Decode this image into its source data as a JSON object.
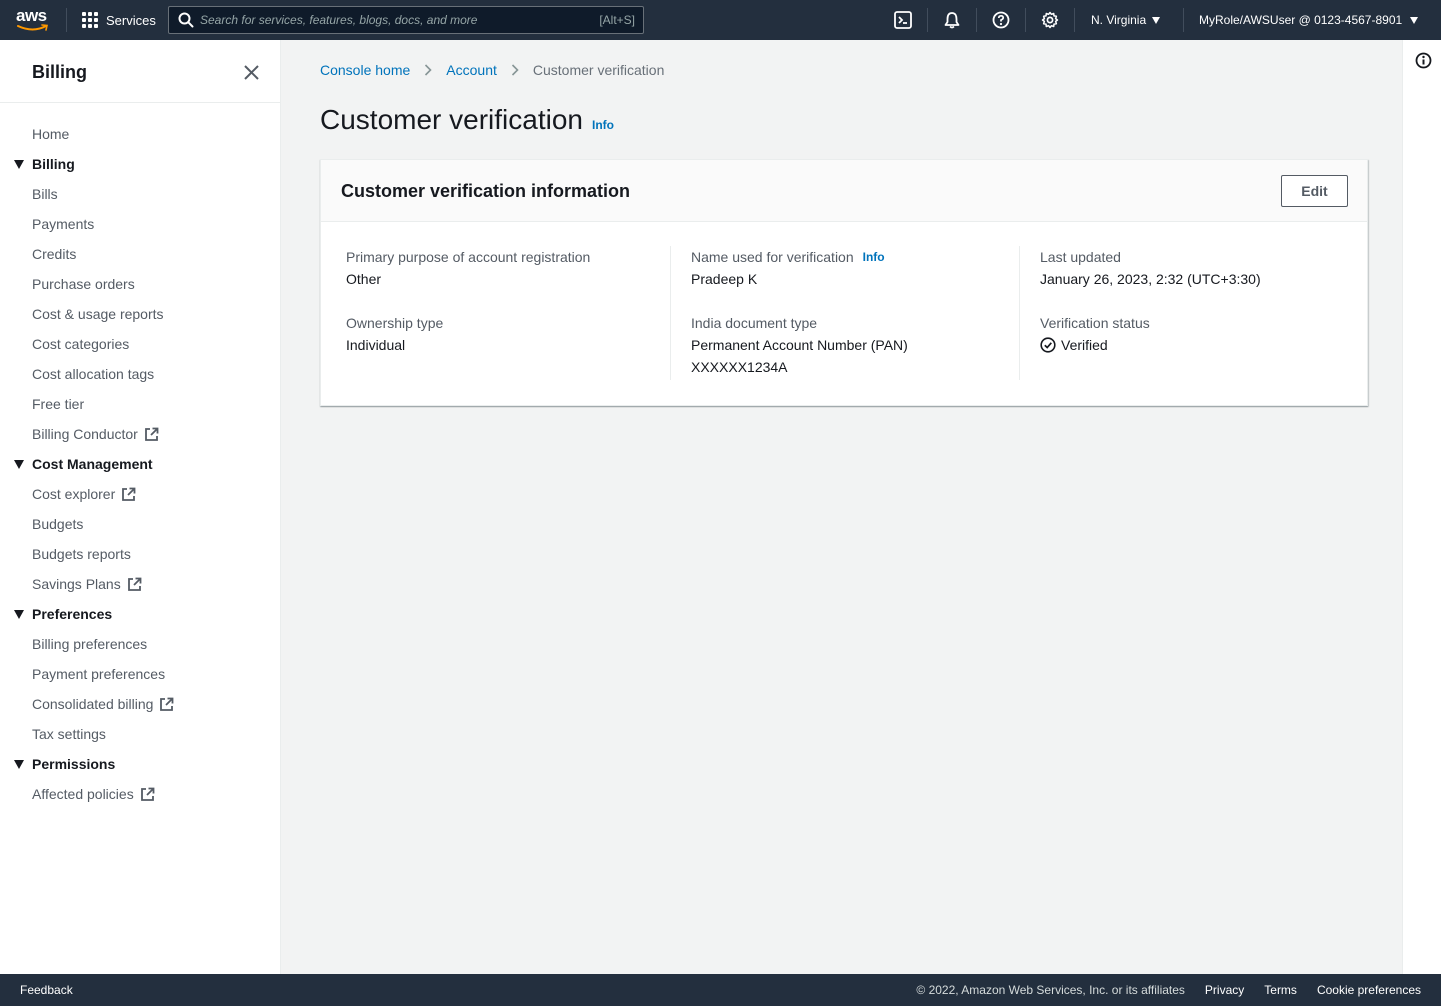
{
  "topnav": {
    "logo": "aws",
    "services_label": "Services",
    "search_placeholder": "Search for services, features, blogs, docs, and more",
    "search_shortcut": "[Alt+S]",
    "region": "N. Virginia",
    "account": "MyRole/AWSUser @ 0123-4567-8901",
    "icons": [
      "cloudshell-icon",
      "bell-icon",
      "help-icon",
      "gear-icon"
    ]
  },
  "sidebar": {
    "title": "Billing",
    "items": [
      {
        "label": "Home",
        "type": "link"
      },
      {
        "label": "Billing",
        "type": "section"
      },
      {
        "label": "Bills",
        "type": "link"
      },
      {
        "label": "Payments",
        "type": "link"
      },
      {
        "label": "Credits",
        "type": "link"
      },
      {
        "label": "Purchase orders",
        "type": "link"
      },
      {
        "label": "Cost & usage reports",
        "type": "link"
      },
      {
        "label": "Cost categories",
        "type": "link"
      },
      {
        "label": "Cost allocation tags",
        "type": "link"
      },
      {
        "label": "Free tier",
        "type": "link"
      },
      {
        "label": "Billing Conductor",
        "type": "external"
      },
      {
        "label": "Cost Management",
        "type": "section"
      },
      {
        "label": "Cost explorer",
        "type": "external"
      },
      {
        "label": "Budgets",
        "type": "link"
      },
      {
        "label": "Budgets reports",
        "type": "link"
      },
      {
        "label": "Savings Plans",
        "type": "external"
      },
      {
        "label": "Preferences",
        "type": "section"
      },
      {
        "label": "Billing preferences",
        "type": "link"
      },
      {
        "label": "Payment preferences",
        "type": "link"
      },
      {
        "label": "Consolidated billing",
        "type": "external"
      },
      {
        "label": "Tax settings",
        "type": "link"
      },
      {
        "label": "Permissions",
        "type": "section"
      },
      {
        "label": "Affected policies",
        "type": "external"
      }
    ]
  },
  "breadcrumb": {
    "items": [
      "Console home",
      "Account",
      "Customer verification"
    ]
  },
  "page": {
    "title": "Customer verification",
    "info": "Info"
  },
  "panel": {
    "title": "Customer verification information",
    "edit_label": "Edit",
    "fields": {
      "purpose_label": "Primary purpose of account registration",
      "purpose_value": "Other",
      "ownership_label": "Ownership type",
      "ownership_value": "Individual",
      "name_label": "Name used for verification",
      "name_info": "Info",
      "name_value": "Pradeep K",
      "doc_label": "India document type",
      "doc_value": "Permanent Account Number (PAN)",
      "doc_number": "XXXXXX1234A",
      "updated_label": "Last updated",
      "updated_value": "January 26, 2023, 2:32 (UTC+3:30)",
      "status_label": "Verification status",
      "status_value": "Verified"
    }
  },
  "footer": {
    "feedback": "Feedback",
    "copyright": "© 2022, Amazon Web Services, Inc. or its affiliates",
    "links": [
      "Privacy",
      "Terms",
      "Cookie preferences"
    ]
  },
  "colors": {
    "nav_bg": "#232f3e",
    "link": "#0073bb",
    "page_bg": "#f2f3f3",
    "text": "#16191f"
  }
}
